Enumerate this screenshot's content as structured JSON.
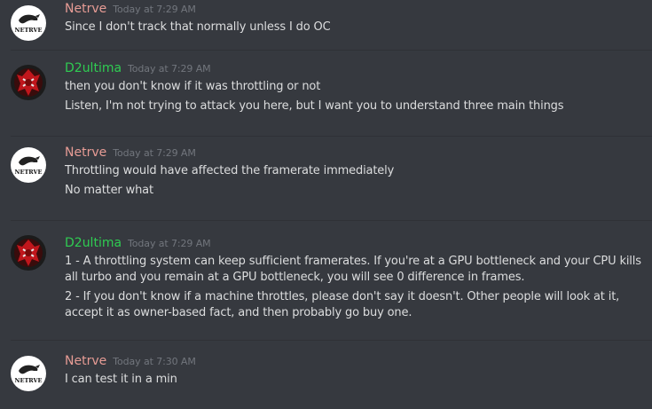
{
  "colors": {
    "background": "#36393f",
    "netrve_name": "#e79c95",
    "d2ultima_name": "#2fcc52",
    "timestamp": "#72767d",
    "text": "#dcddde",
    "divider": "#2f3136"
  },
  "messages": [
    {
      "author": "Netrve",
      "avatar": "netrve-avatar",
      "timestamp": "Today at 7:29 AM",
      "lines": [
        "Since I don't track that normally unless I do OC"
      ]
    },
    {
      "author": "D2ultima",
      "avatar": "d2ultima-avatar",
      "timestamp": "Today at 7:29 AM",
      "lines": [
        "then you don't know if it was throttling or not",
        "Listen, I'm not trying to attack you here, but I want you to understand three main things"
      ]
    },
    {
      "author": "Netrve",
      "avatar": "netrve-avatar",
      "timestamp": "Today at 7:29 AM",
      "lines": [
        "Throttling would have affected the framerate immediately",
        "No matter what"
      ]
    },
    {
      "author": "D2ultima",
      "avatar": "d2ultima-avatar",
      "timestamp": "Today at 7:29 AM",
      "lines": [
        "1 - A throttling system can keep sufficient framerates. If you're at a GPU bottleneck and your CPU kills all turbo and you remain at a GPU bottleneck, you will see 0 difference in frames.",
        "2 - If you don't know if a machine throttles, please don't say it doesn't. Other people will look at it, accept it as owner-based fact, and then probably go buy one."
      ]
    },
    {
      "author": "Netrve",
      "avatar": "netrve-avatar",
      "timestamp": "Today at 7:30 AM",
      "lines": [
        "I can test it in a min"
      ]
    }
  ],
  "avatar_text": {
    "netrve": "NETRVE"
  }
}
